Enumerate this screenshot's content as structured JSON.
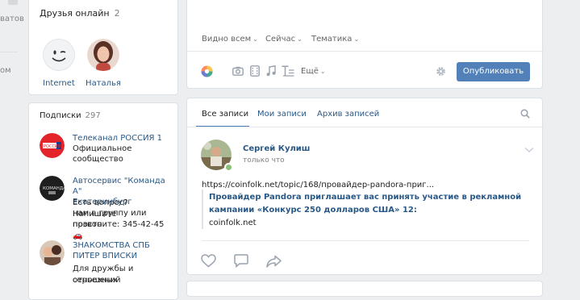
{
  "left_nav": {
    "fragment_1": "ватов",
    "fragment_2": "ом"
  },
  "friends_online": {
    "title": "Друзья онлайн",
    "count": "2",
    "friends": [
      {
        "name": "Internet",
        "avatar": "smiley-avatar"
      },
      {
        "name": "Наталья",
        "avatar": "photo-avatar"
      }
    ]
  },
  "subscriptions": {
    "title": "Подписки",
    "count": "297",
    "items": [
      {
        "name": "Телеканал РОССИЯ 1",
        "desc_1": "Официальное",
        "desc_2": "сообщество",
        "desc_3": ""
      },
      {
        "name": "Автосервис \"Команда А\"",
        "name_2": "Екатеринбург",
        "desc_1": "Есть вопрос? Напишите",
        "desc_2": "нам в группу или просто",
        "desc_3": "позвоните: 345-42-45🚗"
      },
      {
        "name": "ЗНАКОМСТВА СПБ",
        "name_2": "ПИТЕР ВПИСКИ",
        "desc_1": "Для дружбы и серьезных",
        "desc_2": "отношений",
        "desc_3": ""
      }
    ]
  },
  "composer": {
    "visibility": "Видно всем",
    "when": "Сейчас",
    "topic": "Тематика",
    "more_label": "Ещё",
    "publish_label": "Опубликовать"
  },
  "feed": {
    "tabs": [
      "Все записи",
      "Мои записи",
      "Архив записей"
    ],
    "post": {
      "author": "Сергей Кулиш",
      "time": "только что",
      "link_text": "https://coinfolk.net/topic/168/провайдер-pandora-приг...",
      "snippet_title": "Провайдер Pandora приглашает вас принять участие в рекламной кампании «Конкурс 250 долларов США» 12:",
      "snippet_domain": "coinfolk.net"
    }
  },
  "colors": {
    "accent": "#5181b8",
    "link": "#2a5885",
    "background": "#edeef0",
    "online": "#8ac176"
  }
}
